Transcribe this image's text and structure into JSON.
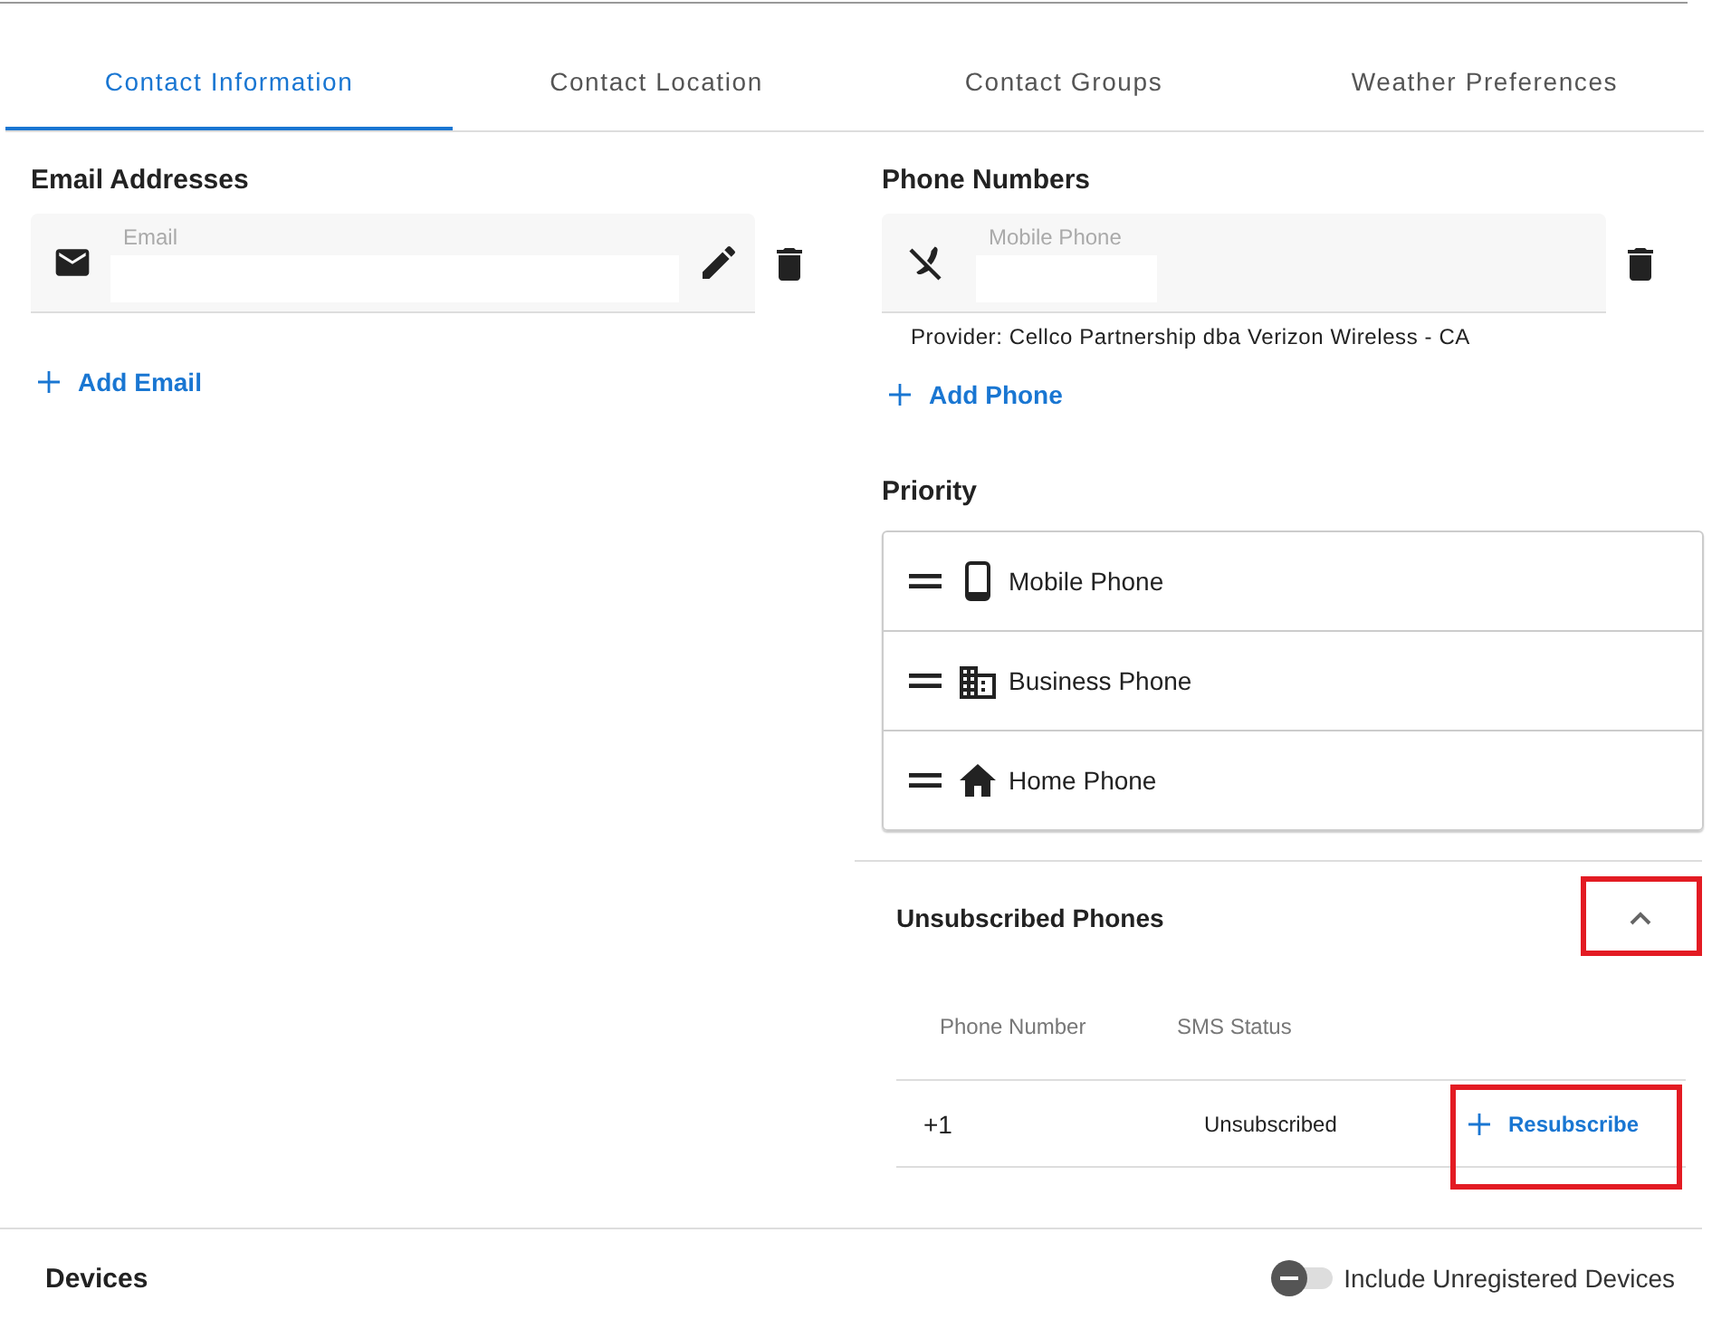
{
  "tabs": [
    {
      "label": "Contact Information",
      "selected": true
    },
    {
      "label": "Contact Location",
      "selected": false
    },
    {
      "label": "Contact Groups",
      "selected": false
    },
    {
      "label": "Weather Preferences",
      "selected": false
    }
  ],
  "email_addresses": {
    "title": "Email Addresses",
    "fields": [
      {
        "label": "Email"
      }
    ],
    "add_label": "Add Email"
  },
  "phone_numbers": {
    "title": "Phone Numbers",
    "fields": [
      {
        "label": "Mobile Phone",
        "provider": "Provider: Cellco Partnership dba Verizon Wireless - CA"
      }
    ],
    "add_label": "Add Phone"
  },
  "priority": {
    "title": "Priority",
    "items": [
      {
        "label": "Mobile Phone",
        "kind": "mobile"
      },
      {
        "label": "Business Phone",
        "kind": "business"
      },
      {
        "label": "Home Phone",
        "kind": "home"
      }
    ]
  },
  "unsubscribed_phones": {
    "title": "Unsubscribed Phones",
    "expanded": true,
    "toggle_highlighted": true,
    "columns": [
      "Phone Number",
      "SMS Status"
    ],
    "rows": [
      {
        "phone_number": "+1",
        "sms_status": "Unsubscribed",
        "action": "Resubscribe",
        "action_highlighted": true
      }
    ]
  },
  "devices": {
    "title": "Devices",
    "toggle": {
      "label": "Include Unregistered Devices",
      "on": false
    }
  }
}
